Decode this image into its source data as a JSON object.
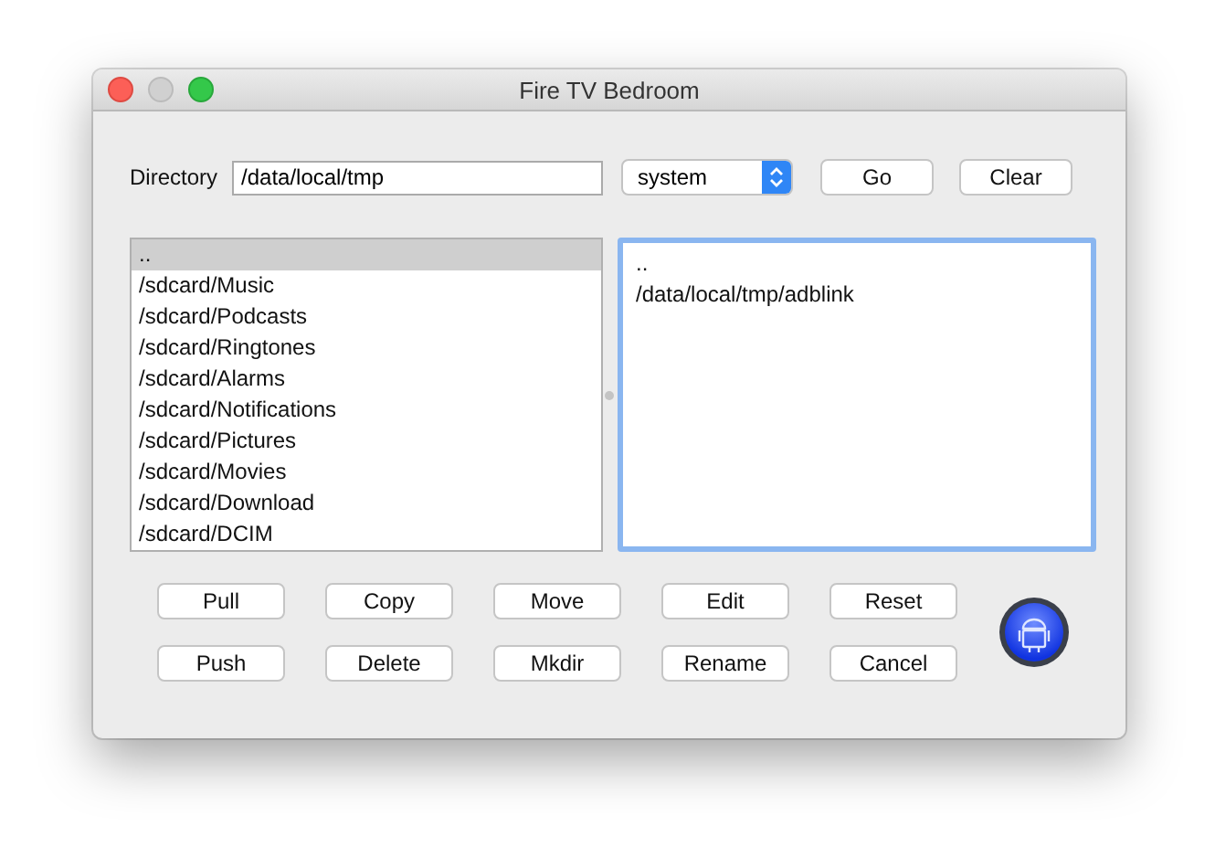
{
  "window": {
    "title": "Fire TV Bedroom"
  },
  "directory": {
    "label": "Directory",
    "value": "/data/local/tmp"
  },
  "mode_select": {
    "value": "system"
  },
  "top_buttons": [
    "Go",
    "Clear"
  ],
  "left_list": {
    "focused": false,
    "items": [
      {
        "text": "..",
        "selected": true
      },
      {
        "text": "/sdcard/Music",
        "selected": false
      },
      {
        "text": "/sdcard/Podcasts",
        "selected": false
      },
      {
        "text": "/sdcard/Ringtones",
        "selected": false
      },
      {
        "text": "/sdcard/Alarms",
        "selected": false
      },
      {
        "text": "/sdcard/Notifications",
        "selected": false
      },
      {
        "text": "/sdcard/Pictures",
        "selected": false
      },
      {
        "text": "/sdcard/Movies",
        "selected": false
      },
      {
        "text": "/sdcard/Download",
        "selected": false
      },
      {
        "text": "/sdcard/DCIM",
        "selected": false
      }
    ]
  },
  "right_list": {
    "focused": true,
    "items": [
      {
        "text": "..",
        "selected": false
      },
      {
        "text": "/data/local/tmp/adblink",
        "selected": false
      }
    ]
  },
  "button_rows": [
    [
      "Pull",
      "Copy",
      "Move",
      "Edit",
      "Reset"
    ],
    [
      "Push",
      "Delete",
      "Mkdir",
      "Rename",
      "Cancel"
    ]
  ]
}
